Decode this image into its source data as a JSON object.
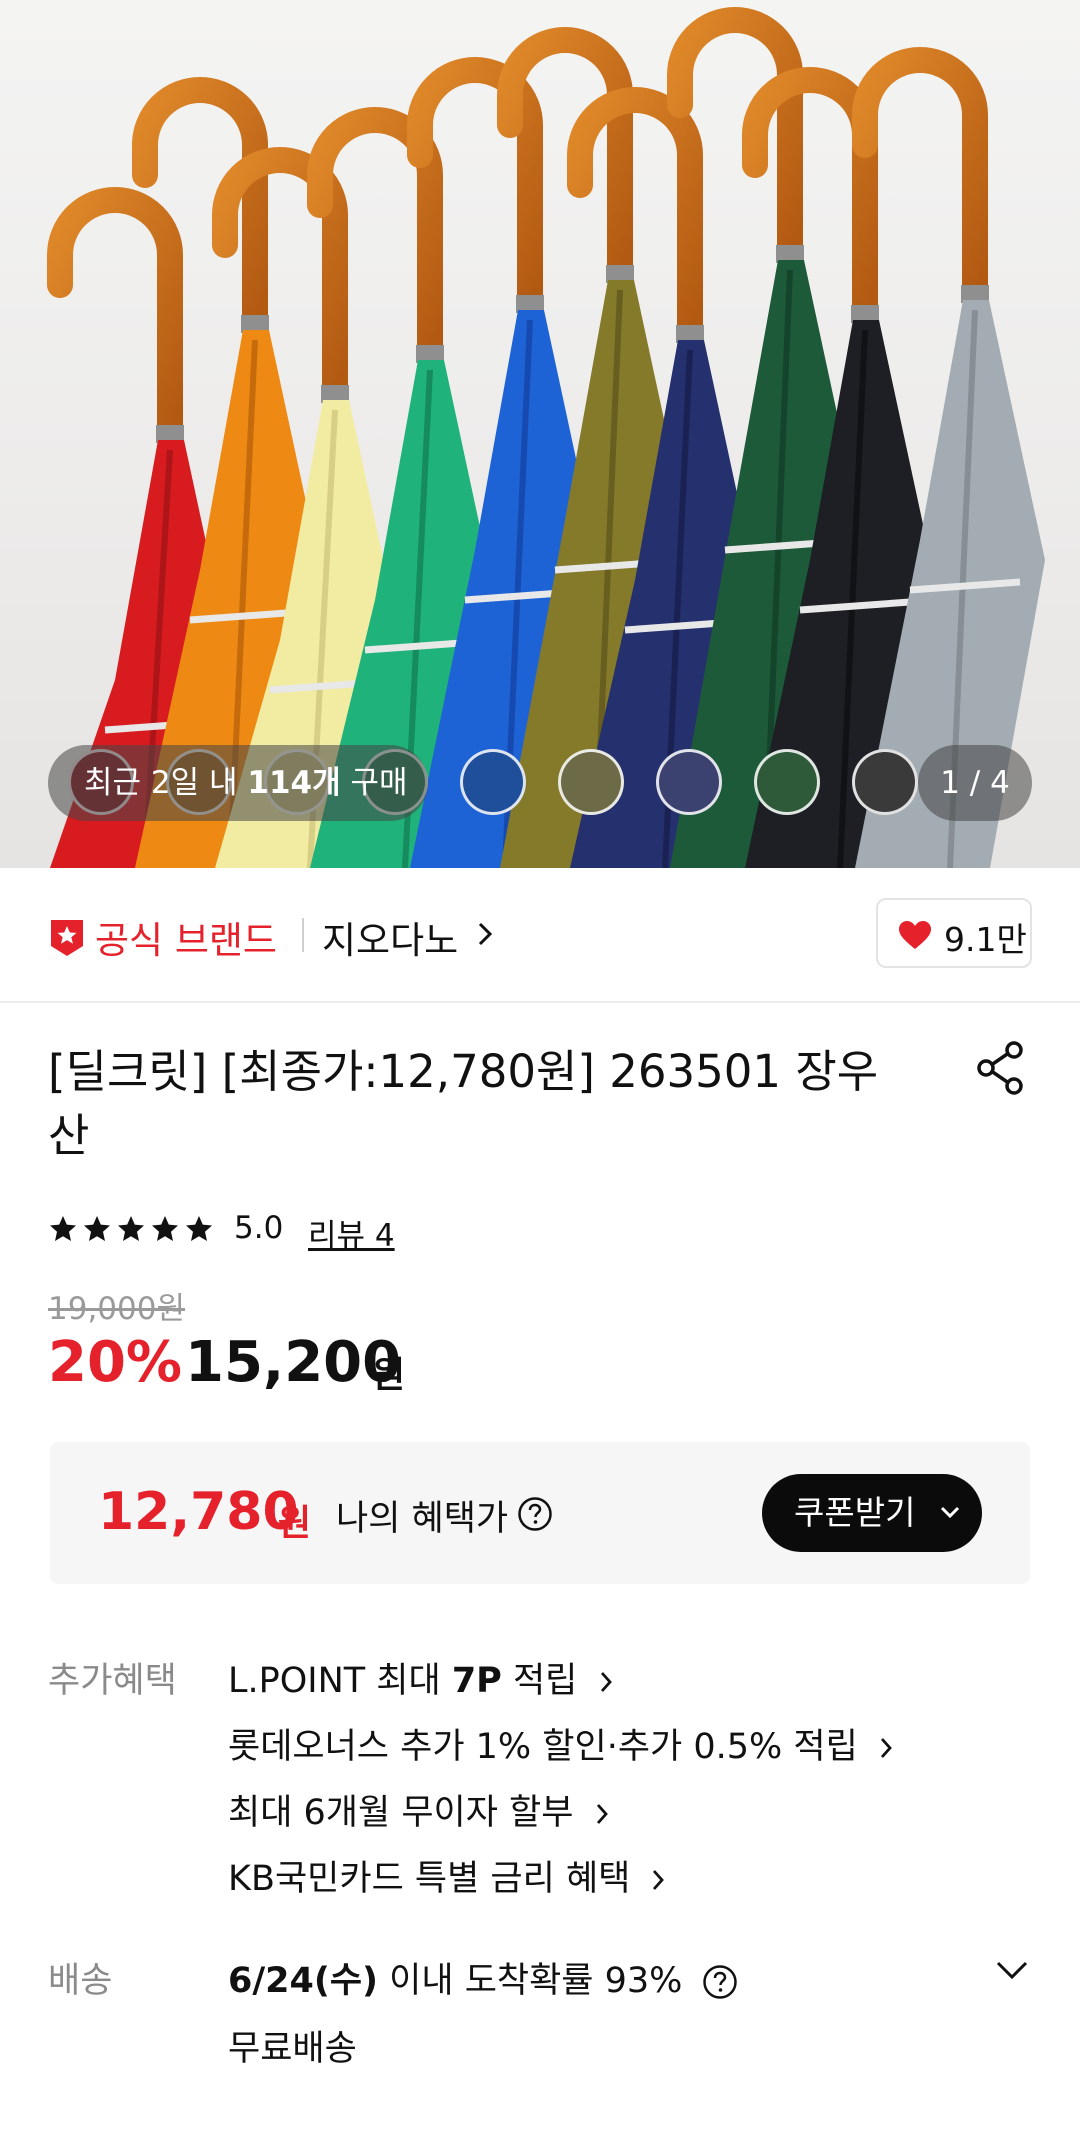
{
  "gallery": {
    "purchase_prefix": "최근 2일 내 ",
    "purchase_count": "114개",
    "purchase_suffix": " 구매",
    "counter": "1 / 4",
    "swatches": [
      "#8a1a22",
      "#a5661c",
      "#c7c27e",
      "#1f7a52",
      "#1f4e9a",
      "#6d6a48",
      "#3c4270",
      "#2f5a3a",
      "#3a3a3a"
    ]
  },
  "brand": {
    "official_label": "공식 브랜드",
    "name": "지오다노",
    "likes": "9.1만"
  },
  "product": {
    "title": "[딜크릿] [최종가:12,780원] 263501 장우산",
    "rating": "5.0",
    "review_link": "리뷰 4",
    "original_price": "19,000원",
    "discount": "20%",
    "price": "15,200",
    "price_unit": "원"
  },
  "my_benefit": {
    "price": "12,780",
    "unit": "원",
    "label": "나의 혜택가",
    "coupon_button": "쿠폰받기"
  },
  "extra_benefits": {
    "label": "추가혜택",
    "items": [
      {
        "pre": "L.POINT 최대 ",
        "bold": "7P",
        "post": " 적립"
      },
      {
        "pre": "롯데오너스 추가 1% 할인·추가 0.5% 적립",
        "bold": "",
        "post": ""
      },
      {
        "pre": "최대 6개월 무이자 할부",
        "bold": "",
        "post": ""
      },
      {
        "pre": "KB국민카드 특별 금리 혜택",
        "bold": "",
        "post": ""
      }
    ]
  },
  "delivery": {
    "label": "배송",
    "date": "6/24(수)",
    "probability_text": " 이내 도착확률 93%",
    "shipping": "무료배송"
  },
  "colors": {
    "accent_red": "#e5212b",
    "button_black": "#0b0b0b"
  }
}
